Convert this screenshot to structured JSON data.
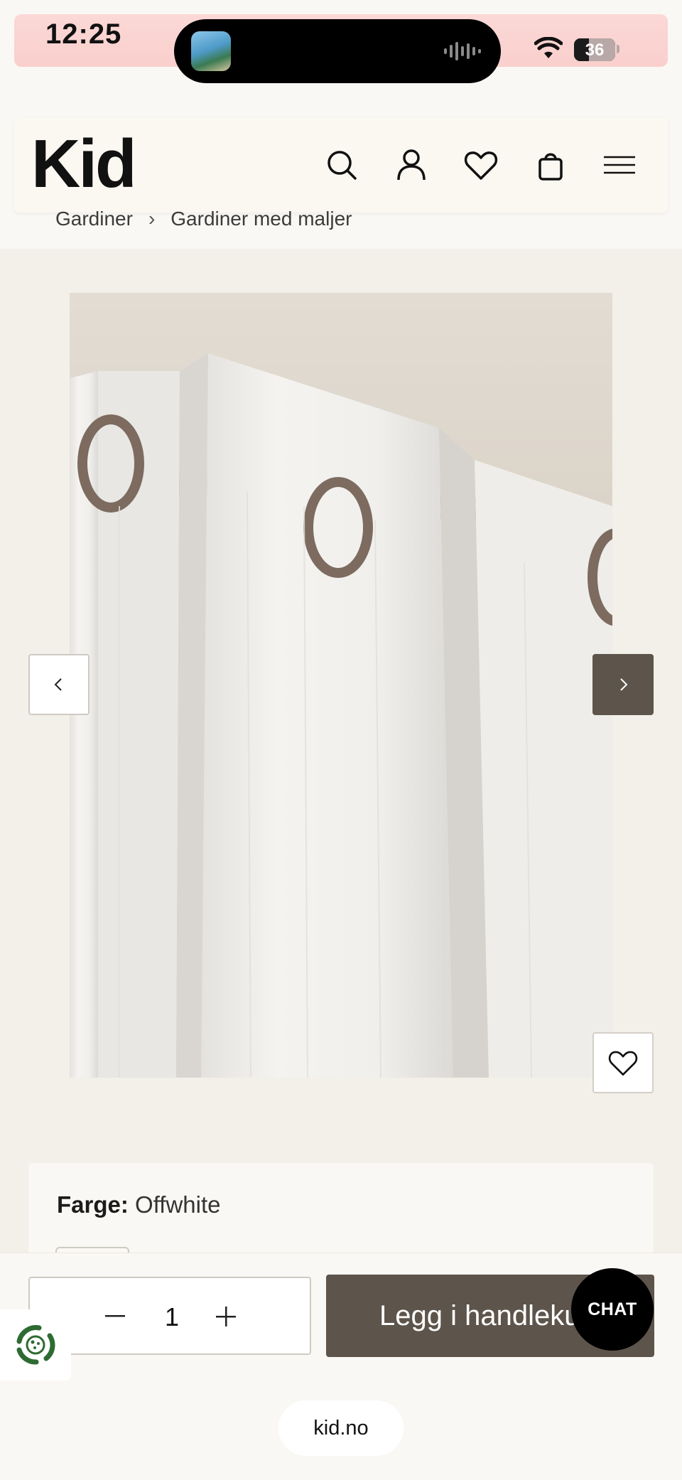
{
  "status_bar": {
    "time": "12:25",
    "battery": "36"
  },
  "header": {
    "logo": "Kid",
    "icons": [
      "search-icon",
      "account-icon",
      "heart-icon",
      "bag-icon",
      "menu-icon"
    ]
  },
  "breadcrumb": {
    "items": [
      "Gardiner",
      "Gardiner med maljer"
    ],
    "separator": "›"
  },
  "product": {
    "image_alt": "Offwhite curtain with eyelets on a metal rod",
    "nav_prev": "‹",
    "nav_next": "›"
  },
  "options": {
    "color_label": "Farge:",
    "color_value": "Offwhite"
  },
  "purchase": {
    "quantity": "1",
    "minus": "−",
    "plus": "+",
    "add_to_cart": "Legg i handlekurv"
  },
  "chat": {
    "label": "CHAT"
  },
  "browser": {
    "url": "kid.no"
  },
  "colors": {
    "accent_brown": "#5d544b",
    "page_bg": "#f3efe9",
    "card_bg": "#faf8f4"
  }
}
